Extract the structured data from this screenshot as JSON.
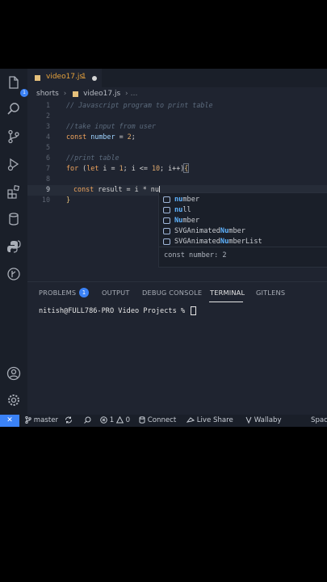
{
  "activity_bar": {
    "explorer_badge": "1",
    "items": [
      "files-icon",
      "search-icon",
      "source-control-icon",
      "run-debug-icon",
      "extensions-icon",
      "database-icon",
      "python-icon",
      "git-graph-icon"
    ],
    "bottom": [
      "account-icon",
      "settings-gear-icon"
    ]
  },
  "tab": {
    "filename": "video17.js",
    "problems": "1"
  },
  "breadcrumb": {
    "folder": "shorts",
    "sep": "›",
    "file": "video17.js",
    "more": "›  …"
  },
  "editor": {
    "lines": [
      {
        "n": "1"
      },
      {
        "n": "2"
      },
      {
        "n": "3"
      },
      {
        "n": "4"
      },
      {
        "n": "5"
      },
      {
        "n": "6"
      },
      {
        "n": "7"
      },
      {
        "n": "8"
      },
      {
        "n": "9"
      },
      {
        "n": "10"
      }
    ],
    "l1": "// Javascript program to print table",
    "l3": "//take input from user",
    "l4_kw": "const",
    "l4_id": "number",
    "l4_op": " = ",
    "l4_num": "2",
    "l4_end": ";",
    "l6": "//print table",
    "l7_kw": "for",
    "l7_a": " (",
    "l7_let": "let",
    "l7_b": " i = ",
    "l7_n1": "1",
    "l7_c": "; i <= ",
    "l7_n2": "10",
    "l7_d": "; i++)",
    "l7_brace": "{",
    "l9_kw": "const",
    "l9_rest": " result = i * nu",
    "l10_brace": "}"
  },
  "suggestions": {
    "items": [
      {
        "match": "nu",
        "rest": "mber"
      },
      {
        "match": "nu",
        "rest": "ll"
      },
      {
        "match": "Nu",
        "rest": "mber"
      },
      {
        "pre": "SVGAnimated",
        "match": "Nu",
        "rest": "mber"
      },
      {
        "pre": "SVGAnimated",
        "match": "Nu",
        "rest": "mberList"
      }
    ],
    "detail": "const number: 2"
  },
  "panel": {
    "tabs": [
      "PROBLEMS",
      "OUTPUT",
      "DEBUG CONSOLE",
      "TERMINAL",
      "GITLENS"
    ],
    "problems_badge": "1",
    "terminal_prompt": "nitish@FULL786-PRO Video Projects % "
  },
  "statusbar": {
    "branch": "master",
    "errors": "1",
    "warnings": "0",
    "connect": "Connect",
    "liveshare": "Live Share",
    "wallaby": "Wallaby",
    "spaces": "Spac"
  },
  "colors": {
    "accent": "#3b82f6",
    "keyword": "#f0a45d",
    "identifier": "#9fd3ff",
    "match": "#5fb3ff"
  }
}
